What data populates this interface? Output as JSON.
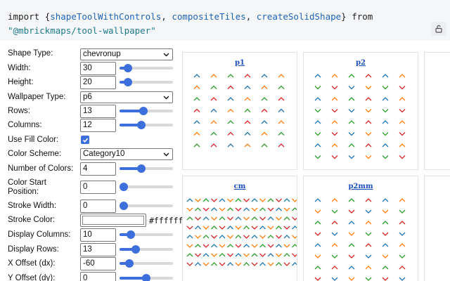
{
  "code": {
    "keyword_import": "import",
    "brace_open": "{",
    "imports": [
      "shapeToolWithControls",
      "compositeTiles",
      "createSolidShape"
    ],
    "brace_close": "}",
    "keyword_from": "from",
    "module": "\"@mbrickmaps/tool-wallpaper\""
  },
  "controls": {
    "shape_type": {
      "label": "Shape Type:",
      "value": "chevronup"
    },
    "width": {
      "label": "Width:",
      "value": "30",
      "slider": 0.1
    },
    "height": {
      "label": "Height:",
      "value": "20",
      "slider": 0.1
    },
    "wallpaper_type": {
      "label": "Wallpaper Type:",
      "value": "p6"
    },
    "rows": {
      "label": "Rows:",
      "value": "13",
      "slider": 0.43
    },
    "columns": {
      "label": "Columns:",
      "value": "12",
      "slider": 0.39
    },
    "use_fill_color": {
      "label": "Use Fill Color:",
      "checked": true
    },
    "color_scheme": {
      "label": "Color Scheme:",
      "value": "Category10"
    },
    "number_of_colors": {
      "label": "Number of Colors:",
      "value": "4",
      "slider": 0.39
    },
    "color_start": {
      "label": "Color Start Position:",
      "value": "0",
      "slider": 0.0
    },
    "stroke_width": {
      "label": "Stroke Width:",
      "value": "0",
      "slider": 0.0
    },
    "stroke_color": {
      "label": "Stroke Color:",
      "value": "#ffffff"
    },
    "display_columns": {
      "label": "Display Columns:",
      "value": "10",
      "slider": 0.16
    },
    "display_rows": {
      "label": "Display Rows:",
      "value": "13",
      "slider": 0.26
    },
    "x_offset": {
      "label": "X Offset (dx):",
      "value": "-60",
      "slider": 0.13
    },
    "y_offset": {
      "label": "Y Offset (dy):",
      "value": "0",
      "slider": 0.5
    }
  },
  "palette": [
    "#1f77b4",
    "#ff7f0e",
    "#2ca02c",
    "#d62728"
  ],
  "tiles": [
    {
      "title": "p1"
    },
    {
      "title": "p2"
    },
    {
      "title": "cm"
    },
    {
      "title": "p2mm"
    }
  ]
}
